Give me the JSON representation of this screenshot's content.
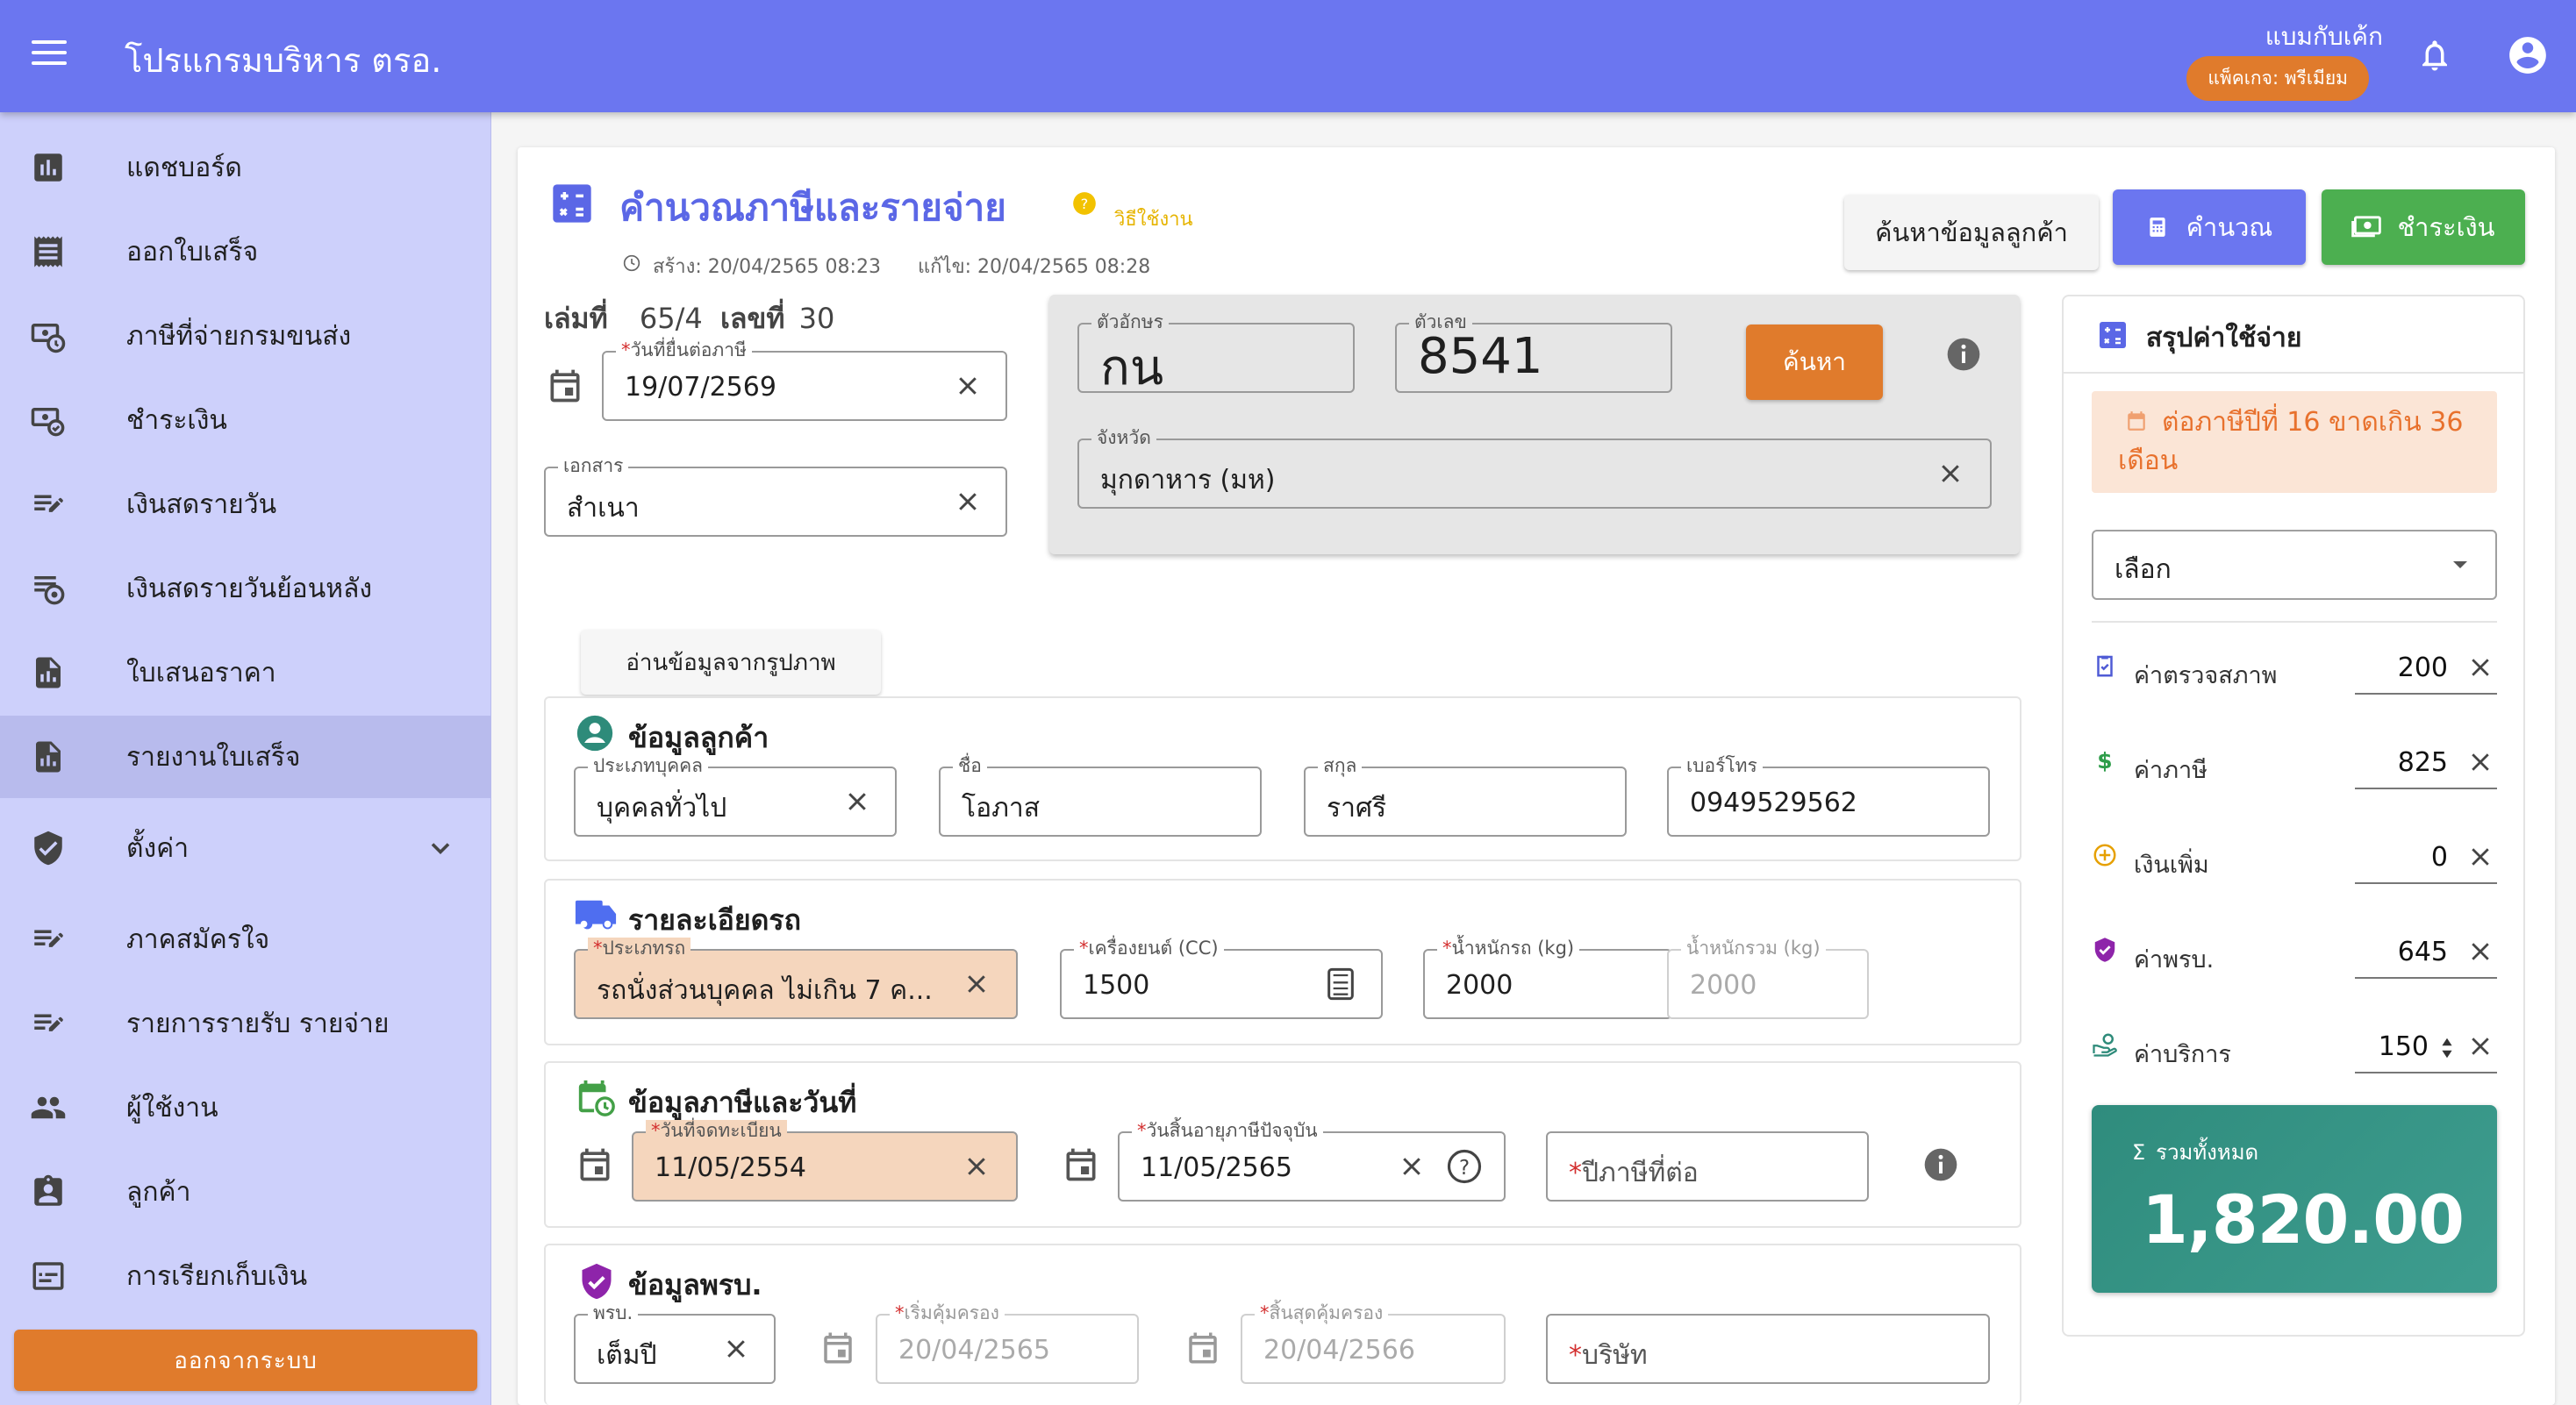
{
  "app": {
    "title": "โปรแกรมบริหาร ตรอ.",
    "user_name": "แบมกับเค้ก",
    "package": "แพ็คเกจ: พรีเมียม"
  },
  "sidebar": {
    "items": [
      {
        "label": "แดชบอร์ด",
        "icon": "bar-chart-icon"
      },
      {
        "label": "ออกใบเสร็จ",
        "icon": "receipt-icon"
      },
      {
        "label": "ภาษีที่จ่ายกรมขนส่ง",
        "icon": "history-money-icon"
      },
      {
        "label": "ชำระเงิน",
        "icon": "payment-icon"
      },
      {
        "label": "เงินสดรายวัน",
        "icon": "edit-note-icon"
      },
      {
        "label": "เงินสดรายวันย้อนหลัง",
        "icon": "view-history-icon"
      },
      {
        "label": "ใบเสนอราคา",
        "icon": "report-icon"
      },
      {
        "label": "รายงานใบเสร็จ",
        "icon": "report-icon"
      },
      {
        "label": "ตั้งค่า",
        "icon": "shield-icon"
      },
      {
        "label": "ภาคสมัครใจ",
        "icon": "edit-note-icon"
      },
      {
        "label": "รายการรายรับ รายจ่าย",
        "icon": "edit-note-icon"
      },
      {
        "label": "ผู้ใช้งาน",
        "icon": "users-icon"
      },
      {
        "label": "ลูกค้า",
        "icon": "customer-icon"
      },
      {
        "label": "การเรียกเก็บเงิน",
        "icon": "billing-icon"
      }
    ],
    "logout": "ออกจากระบบ"
  },
  "page": {
    "title": "คำนวณภาษีและรายจ่าย",
    "help": "วิธีใช้งาน",
    "created": "สร้าง: 20/04/2565 08:23",
    "edited": "แก้ไข: 20/04/2565 08:28",
    "btn_find_customer": "ค้นหาข้อมูลลูกค้า",
    "btn_calculate": "คำนวณ",
    "btn_pay": "ชำระเงิน",
    "book_label": "เล่มที่",
    "book_no": "65/4",
    "no_label": "เลขที่",
    "no": "30"
  },
  "form": {
    "tax_date": {
      "label": "วันที่ยื่นต่อภาษี",
      "value": "19/07/2569"
    },
    "document": {
      "label": "เอกสาร",
      "value": "สำเนา"
    },
    "plate_letters": {
      "label": "ตัวอักษร",
      "value": "กน"
    },
    "plate_number": {
      "label": "ตัวเลข",
      "value": "8541"
    },
    "search": "ค้นหา",
    "province": {
      "label": "จังหวัด",
      "value": "มุกดาหาร (มห)"
    },
    "read_image": "อ่านข้อมูลจากรูปภาพ"
  },
  "customer": {
    "title": "ข้อมูลลูกค้า",
    "type": {
      "label": "ประเภทบุคคล",
      "value": "บุคคลทั่วไป"
    },
    "first_name": {
      "label": "ชื่อ",
      "value": "โอภาส"
    },
    "last_name": {
      "label": "สกุล",
      "value": "ราศรี"
    },
    "phone": {
      "label": "เบอร์โทร",
      "value": "0949529562"
    }
  },
  "vehicle": {
    "title": "รายละเอียดรถ",
    "type": {
      "label": "ประเภทรถ",
      "value": "รถนั่งส่วนบุคคล ไม่เกิน 7 ค..."
    },
    "engine": {
      "label": "เครื่องยนต์ (CC)",
      "value": "1500"
    },
    "weight": {
      "label": "น้ำหนักรถ (kg)",
      "value": "2000"
    },
    "gross_weight": {
      "label": "น้ำหนักรวม (kg)",
      "value": "2000"
    }
  },
  "tax_info": {
    "title": "ข้อมูลภาษีและวันที่",
    "reg_date": {
      "label": "วันที่จดทะเบียน",
      "value": "11/05/2554"
    },
    "expiry": {
      "label": "วันสิ้นอายุภาษีปัจจุบัน",
      "value": "11/05/2565"
    },
    "tax_year": {
      "placeholder": "ปีภาษีที่ต่อ"
    }
  },
  "prb": {
    "title": "ข้อมูลพรบ.",
    "type": {
      "label": "พรบ.",
      "value": "เต็มปี"
    },
    "start": {
      "label": "เริ่มคุ้มครอง",
      "value": "20/04/2565"
    },
    "end": {
      "label": "สิ้นสุดคุ้มครอง",
      "value": "20/04/2566"
    },
    "company": {
      "placeholder": "บริษัท"
    }
  },
  "summary": {
    "title": "สรุปค่าใช้จ่าย",
    "warning": "ต่อภาษีปีที่ 16 ขาดเกิน 36 เดือน",
    "select": "เลือก",
    "costs": [
      {
        "label": "ค่าตรวจสภาพ",
        "value": "200",
        "icon": "clipboard-check-icon",
        "color": "#4f5bd5"
      },
      {
        "label": "ค่าภาษี",
        "value": "825",
        "icon": "dollar-icon",
        "color": "#2e9d4a"
      },
      {
        "label": "เงินเพิ่ม",
        "value": "0",
        "icon": "plus-circle-icon",
        "color": "#e6a000"
      },
      {
        "label": "ค่าพรบ.",
        "value": "645",
        "icon": "verified-shield-icon",
        "color": "#8e24aa"
      },
      {
        "label": "ค่าบริการ",
        "value": "150",
        "icon": "service-hand-icon",
        "color": "#2e8b7a"
      }
    ],
    "total_label": "รวมทั้งหมด",
    "total_value": "1,820.00"
  },
  "colors": {
    "primary": "#6b76f0",
    "orange": "#e07b2c",
    "green": "#4caf50",
    "sidebar": "#cdd0fb",
    "total": "#2f8c7d"
  }
}
